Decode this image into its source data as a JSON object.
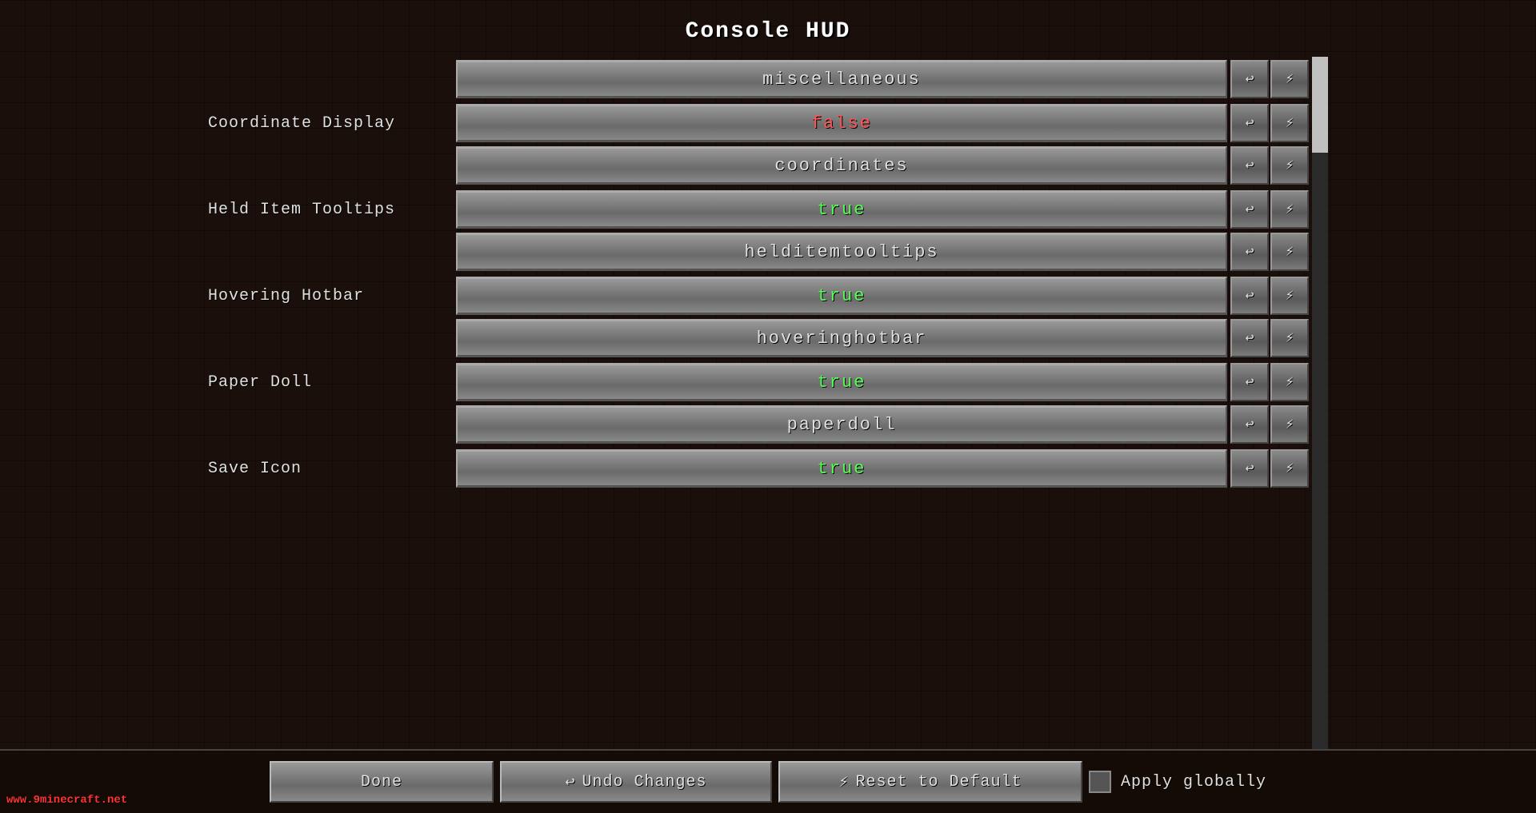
{
  "title": "Console HUD",
  "sections": [
    {
      "type": "section",
      "label": "miscellaneous",
      "undoIcon": "↩",
      "resetIcon": "⚡"
    },
    {
      "type": "setting",
      "name": "Coordinate Display",
      "value": "false",
      "valueClass": "value-false",
      "key": "coordinates",
      "undoIcon": "↩",
      "resetIcon": "⚡"
    },
    {
      "type": "setting",
      "name": "Held Item Tooltips",
      "value": "true",
      "valueClass": "value-true",
      "key": "helditemtooltips",
      "undoIcon": "↩",
      "resetIcon": "⚡"
    },
    {
      "type": "setting",
      "name": "Hovering Hotbar",
      "value": "true",
      "valueClass": "value-true",
      "key": "hoveringhotbar",
      "undoIcon": "↩",
      "resetIcon": "⚡"
    },
    {
      "type": "setting",
      "name": "Paper Doll",
      "value": "true",
      "valueClass": "value-true",
      "key": "paperdoll",
      "undoIcon": "↩",
      "resetIcon": "⚡"
    },
    {
      "type": "setting",
      "name": "Save Icon",
      "value": "true",
      "valueClass": "value-true",
      "key": null,
      "undoIcon": "↩",
      "resetIcon": "⚡"
    }
  ],
  "buttons": {
    "done": "Done",
    "undoIcon": "↩",
    "undo": "Undo Changes",
    "resetIcon": "⚡",
    "reset": "Reset to Default",
    "apply": "Apply globally"
  },
  "watermark": "www.9minecraft.net"
}
